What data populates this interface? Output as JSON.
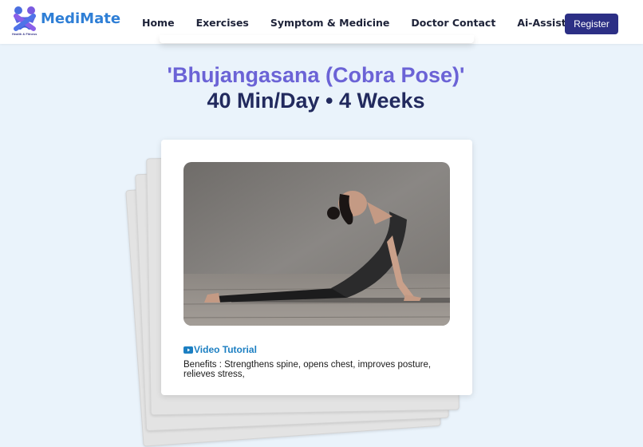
{
  "brand": {
    "name": "MediMate",
    "tagline": "Health & Fitness",
    "primary_color": "#2f7fd6"
  },
  "nav": {
    "items": [
      {
        "label": "Home"
      },
      {
        "label": "Exercises"
      },
      {
        "label": "Symptom & Medicine"
      },
      {
        "label": "Doctor Contact"
      },
      {
        "label": "Ai-Assistant"
      }
    ],
    "register_label": "Register",
    "register_color": "#2c2f85"
  },
  "hero": {
    "title": "'Bhujangasana (Cobra Pose)'",
    "subtitle": "40 Min/Day • 4 Weeks",
    "title_color": "#6b63d6",
    "subtitle_color": "#222a5e"
  },
  "card": {
    "image_icon": "yoga-cobra-pose-photo",
    "video_icon": "youtube-icon",
    "video_label": "Video Tutorial",
    "benefits_text": "Benefits : Strengthens spine, opens chest, improves posture, relieves stress,"
  }
}
